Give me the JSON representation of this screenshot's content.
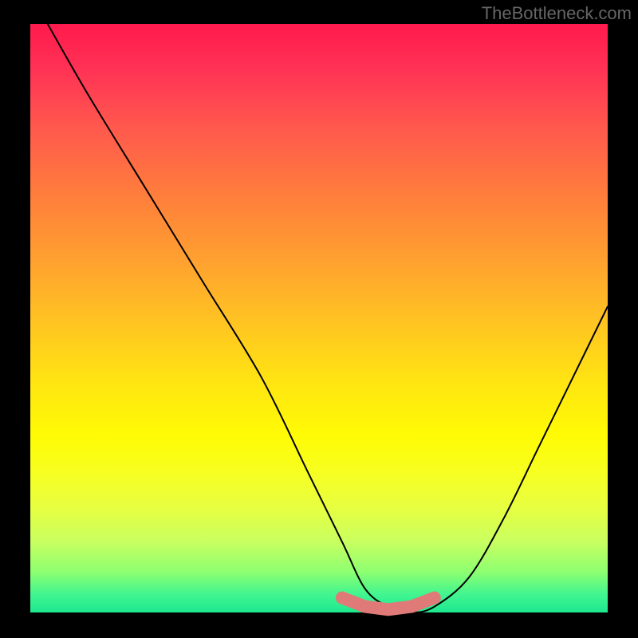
{
  "watermark": "TheBottleneck.com",
  "chart_data": {
    "type": "line",
    "title": "",
    "xlabel": "",
    "ylabel": "",
    "xlim": [
      0,
      100
    ],
    "ylim": [
      0,
      100
    ],
    "series": [
      {
        "name": "bottleneck-curve",
        "x": [
          3,
          10,
          20,
          30,
          40,
          48,
          54,
          58,
          62,
          66,
          70,
          76,
          82,
          88,
          94,
          100
        ],
        "values": [
          100,
          88,
          72,
          56,
          40,
          24,
          12,
          4,
          1,
          0,
          1,
          6,
          16,
          28,
          40,
          52
        ]
      }
    ],
    "markers": {
      "name": "highlight-band",
      "color": "#e07a78",
      "x": [
        54,
        58,
        62,
        66,
        70
      ],
      "values": [
        2.5,
        1,
        0.5,
        1,
        2.5
      ]
    },
    "gradient_stops": [
      {
        "pos": 0,
        "color": "#ff1a4d"
      },
      {
        "pos": 50,
        "color": "#ffc820"
      },
      {
        "pos": 75,
        "color": "#fffb05"
      },
      {
        "pos": 100,
        "color": "#1ee890"
      }
    ]
  }
}
